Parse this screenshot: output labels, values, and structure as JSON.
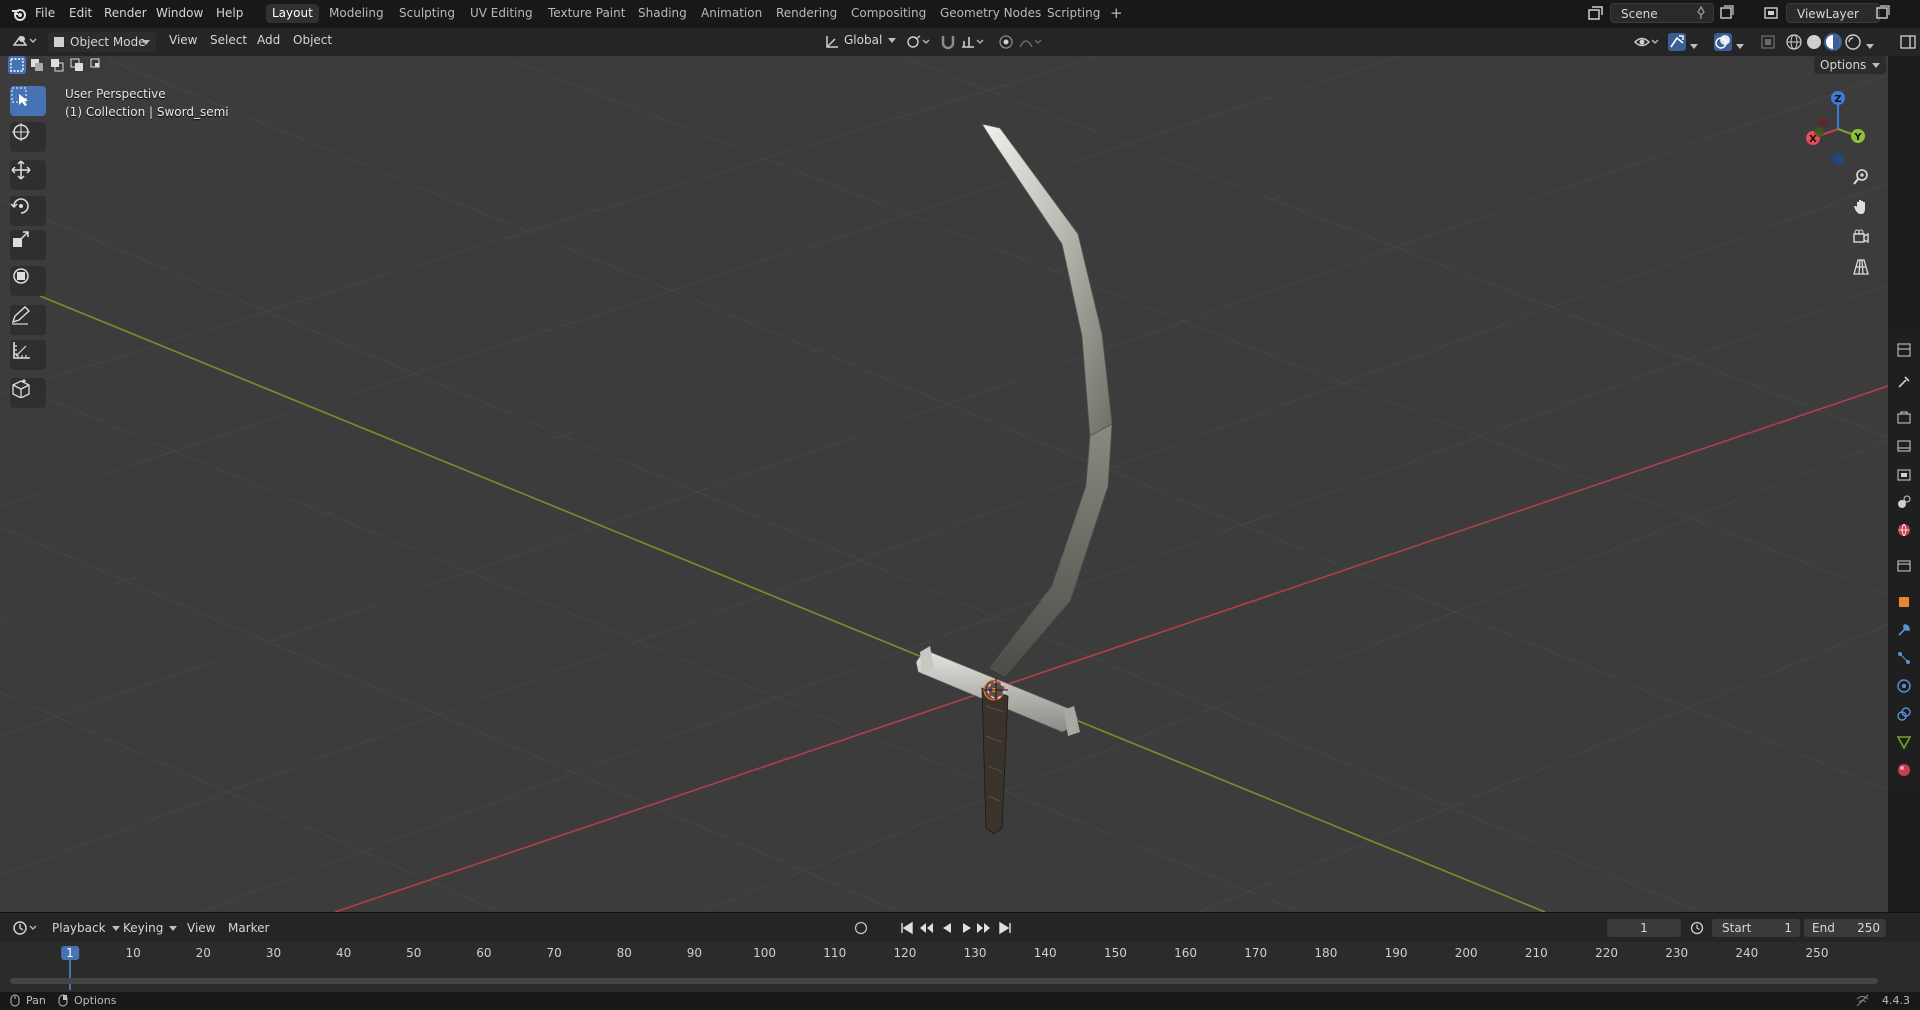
{
  "topbar": {
    "menus": [
      "File",
      "Edit",
      "Render",
      "Window",
      "Help"
    ],
    "workspaces": [
      "Layout",
      "Modeling",
      "Sculpting",
      "UV Editing",
      "Texture Paint",
      "Shading",
      "Animation",
      "Rendering",
      "Compositing",
      "Geometry Nodes",
      "Scripting"
    ],
    "active_workspace": "Layout",
    "add_workspace": "+",
    "scene": "Scene",
    "view_layer": "ViewLayer"
  },
  "viewport_header": {
    "mode": "Object Mode",
    "menus": [
      "View",
      "Select",
      "Add",
      "Object"
    ],
    "orientation": "Global",
    "options": "Options"
  },
  "viewport": {
    "perspective": "User Perspective",
    "collection": "(1) Collection | Sword_semi",
    "gizmo": {
      "x": "X",
      "y": "Y",
      "z": "Z"
    }
  },
  "tools": [
    "select-box",
    "cursor",
    "move",
    "rotate",
    "scale",
    "transform",
    "annotate",
    "measure",
    "add-cube"
  ],
  "timeline": {
    "menus": [
      "Playback",
      "Keying",
      "View",
      "Marker"
    ],
    "current_frame": "1",
    "start_label": "Start",
    "start_value": "1",
    "end_label": "End",
    "end_value": "250",
    "ticks": [
      "1",
      "10",
      "20",
      "30",
      "40",
      "50",
      "60",
      "70",
      "80",
      "90",
      "100",
      "110",
      "120",
      "130",
      "140",
      "150",
      "160",
      "170",
      "180",
      "190",
      "200",
      "210",
      "220",
      "230",
      "240",
      "250"
    ]
  },
  "statusbar": {
    "pan": "Pan",
    "options": "Options",
    "version": "4.4.3"
  },
  "colors": {
    "accent": "#4772b3",
    "x_axis": "#c4404e",
    "y_axis": "#7aa32a",
    "z_axis": "#3d7bd6"
  }
}
